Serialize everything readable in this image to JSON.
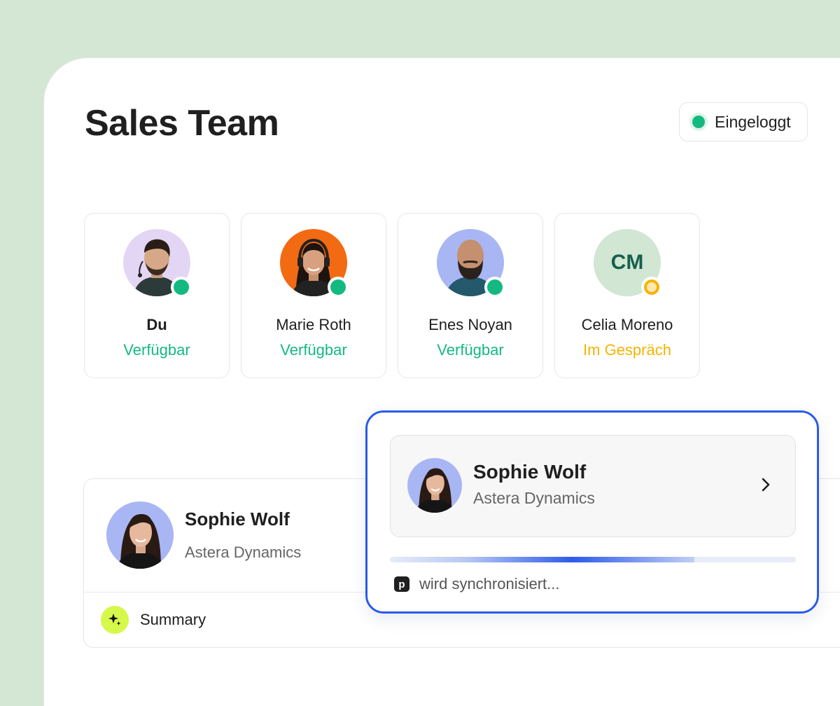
{
  "header": {
    "title": "Sales Team",
    "login_status": "Eingeloggt"
  },
  "team": [
    {
      "name": "Du",
      "status": "Verfügbar",
      "status_color": "#14b981",
      "avatar": "photo-man-beard-headset"
    },
    {
      "name": "Marie Roth",
      "status": "Verfügbar",
      "status_color": "#14b981",
      "avatar": "photo-woman-headset"
    },
    {
      "name": "Enes Noyan",
      "status": "Verfügbar",
      "status_color": "#14b981",
      "avatar": "photo-bald-man-beard"
    },
    {
      "name": "Celia Moreno",
      "initials": "CM",
      "status": "Im Gespräch",
      "status_color": "#f5b400"
    }
  ],
  "contact": {
    "name": "Sophie Wolf",
    "company": "Astera Dynamics",
    "summary_label": "Summary"
  },
  "sync": {
    "name": "Sophie Wolf",
    "company": "Astera Dynamics",
    "status_text": "wird synchronisiert...",
    "progress": 0.75,
    "app_icon_letter": "p"
  },
  "colors": {
    "background": "#d3e7d4",
    "available": "#14b981",
    "busy": "#f5b400",
    "accent_blue": "#2c5be8",
    "spark": "#d6f84a"
  }
}
